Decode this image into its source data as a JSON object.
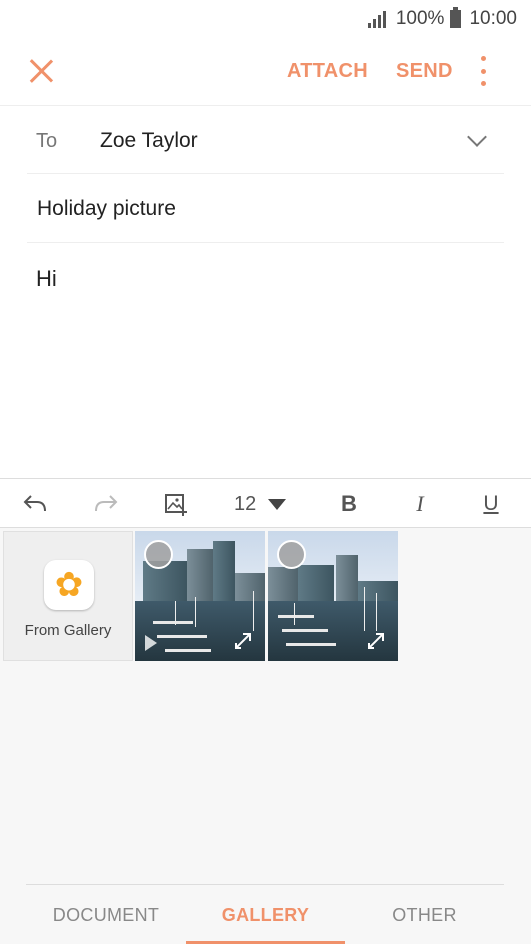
{
  "status_bar": {
    "battery": "100%",
    "time": "10:00"
  },
  "toolbar": {
    "attach_label": "ATTACH",
    "send_label": "SEND"
  },
  "compose": {
    "to_label": "To",
    "to_value": "Zoe Taylor",
    "subject": "Holiday picture",
    "body": "Hi"
  },
  "format_bar": {
    "font_size": "12",
    "bold_label": "B",
    "italic_label": "I",
    "underline_label": "U"
  },
  "picker": {
    "from_gallery_label": "From Gallery",
    "thumbnails": [
      "photo-1",
      "photo-2"
    ]
  },
  "tabs": [
    {
      "label": "DOCUMENT",
      "active": false
    },
    {
      "label": "GALLERY",
      "active": true
    },
    {
      "label": "OTHER",
      "active": false
    }
  ],
  "colors": {
    "accent": "#f0916a",
    "gallery_icon": "#f6a623"
  },
  "icons": [
    "close-icon",
    "more-icon",
    "chevron-down-icon",
    "undo-icon",
    "redo-icon",
    "insert-image-icon",
    "flower-icon",
    "expand-icon"
  ]
}
